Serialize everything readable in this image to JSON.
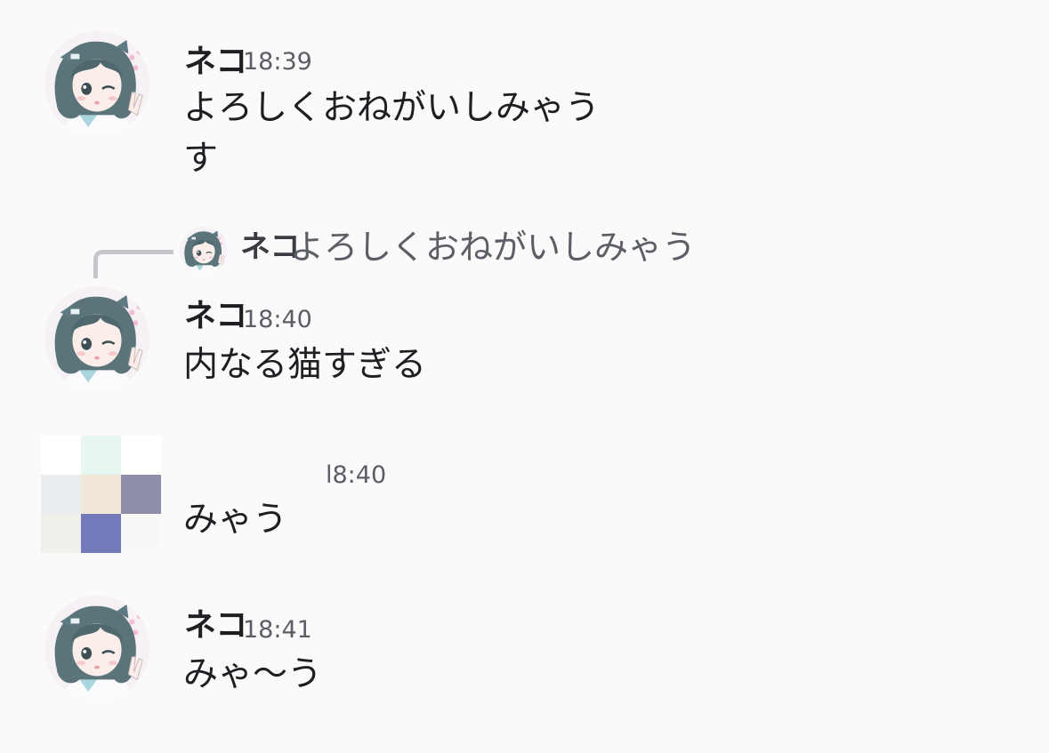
{
  "messages": [
    {
      "author": "ネコ",
      "time": "18:39",
      "lines": [
        "よろしくおねがいしみゃう",
        "す"
      ]
    },
    {
      "reply": {
        "author": "ネコ",
        "text": "よろしくおねがいしみゃう"
      },
      "author": "ネコ",
      "time": "18:40",
      "lines": [
        "内なる猫すぎる"
      ]
    },
    {
      "author": "",
      "time": "18:40",
      "time_visible": "l8:40",
      "lines": [
        "みゃう"
      ]
    },
    {
      "author": "ネコ",
      "time": "18:41",
      "lines": [
        "みゃ〜う"
      ]
    }
  ],
  "colors": {
    "background": "#fafafb",
    "text": "#1e1f22",
    "muted": "#5c5e66",
    "reply_line": "#c4c6cc"
  },
  "censored_pixels": [
    "#ffffff",
    "#e8f6f0",
    "#ffffff",
    "#e9edef",
    "#f1e8da",
    "#8f8ea8",
    "#eff0ea",
    "#7379b9",
    "#f8f8f8"
  ]
}
